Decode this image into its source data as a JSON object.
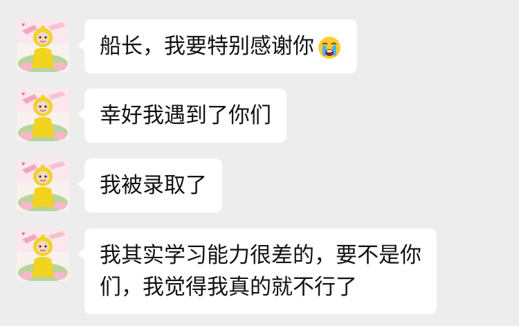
{
  "messages": [
    {
      "lines": [
        "船长，我要特别感谢你"
      ],
      "emoji": "loudly-crying-face"
    },
    {
      "lines": [
        "幸好我遇到了你们"
      ]
    },
    {
      "lines": [
        "我被录取了"
      ]
    },
    {
      "lines": [
        "我其实学习能力很差的，要不是你",
        "们，我觉得我真的就不行了"
      ]
    }
  ],
  "colors": {
    "background": "#ededed",
    "bubble": "#ffffff",
    "text": "#111111"
  }
}
